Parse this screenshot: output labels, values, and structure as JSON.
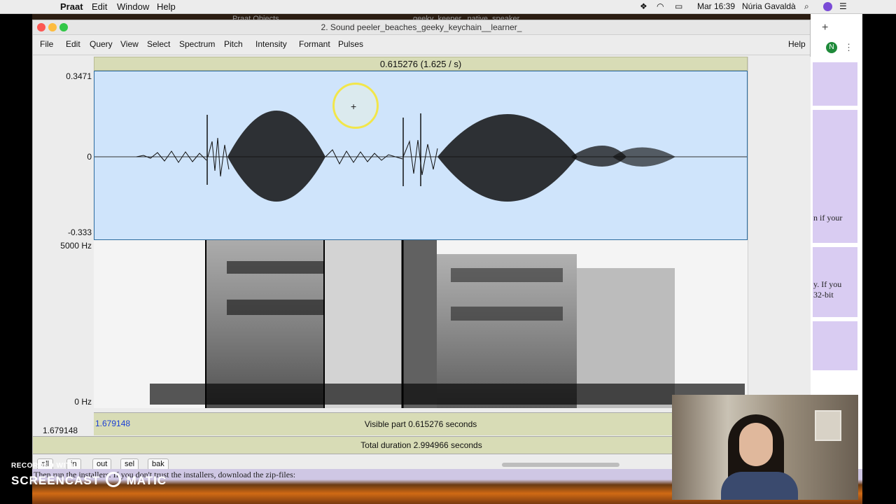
{
  "menubar": {
    "app": "Praat",
    "items": [
      "Edit",
      "Window",
      "Help"
    ],
    "clock": "Mar 16:39",
    "user": "Núria Gavaldà"
  },
  "background_titles": {
    "left": "Praat Objects",
    "right": "geeky_keeper...native_speaker"
  },
  "window": {
    "title": "2. Sound peeler_beaches_geeky_keychain__learner_",
    "menus": [
      "File",
      "Edit",
      "Query",
      "View",
      "Select",
      "Spectrum",
      "Pitch",
      "Intensity",
      "Formant",
      "Pulses"
    ],
    "help": "Help"
  },
  "editor": {
    "window_duration": "0.615276 (1.625 / s)",
    "wave_max": "0.3471",
    "wave_zero": "0",
    "wave_min": "-0.333",
    "spec_max": "5000 Hz",
    "spec_min": "0 Hz",
    "left_time": "1.679148",
    "start_time": "1.679148",
    "visible_part": "Visible part 0.615276 seconds",
    "total_duration": "Total duration 2.994966 seconds"
  },
  "buttons": [
    "all",
    "in",
    "out",
    "sel",
    "bak"
  ],
  "browser": {
    "plus": "+",
    "avatar": "N",
    "text1": "n if your",
    "text2": "y. If you\n32-bit"
  },
  "page_behind": {
    "text": "Then run the installers. If you don't trust the installers, download the zip-files:"
  },
  "watermark": {
    "line1": "RECORDED WITH",
    "line2a": "SCREENCAST",
    "line2b": "MATIC"
  },
  "colors": {
    "wave_bg": "#cfe4fb",
    "time_bar": "#d8dcb6",
    "cursor_circle": "#f2e64a",
    "start_time_color": "#1a3fd6"
  }
}
